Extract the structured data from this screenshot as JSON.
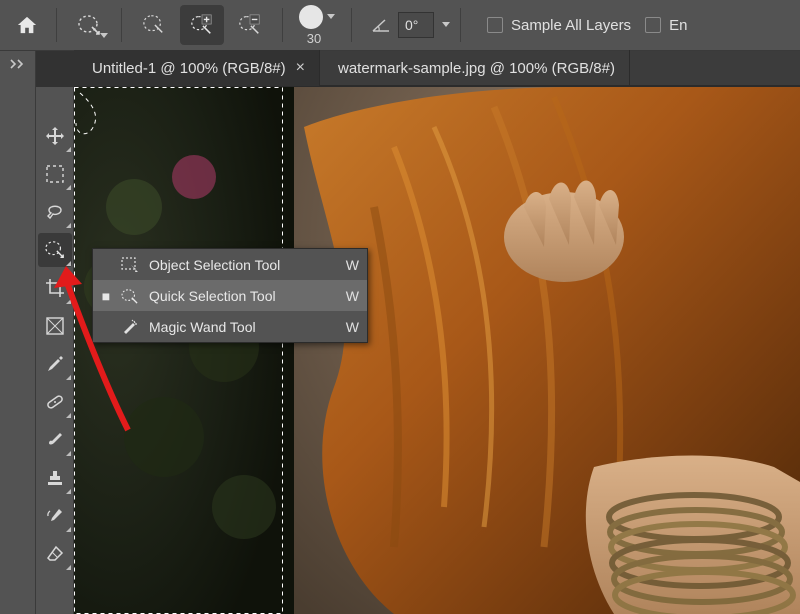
{
  "topbar": {
    "brush_size": "30",
    "angle": "0°",
    "sample_all_layers": "Sample All Layers",
    "enhance_partial": "En"
  },
  "tabs": [
    {
      "label": "Untitled-1 @ 100% (RGB/8#)",
      "active": true,
      "closable": true
    },
    {
      "label": "watermark-sample.jpg @ 100% (RGB/8#)",
      "active": false,
      "closable": false
    }
  ],
  "flyout": {
    "items": [
      {
        "label": "Object Selection Tool",
        "shortcut": "W",
        "selected": false,
        "current": false
      },
      {
        "label": "Quick Selection Tool",
        "shortcut": "W",
        "selected": true,
        "current": true
      },
      {
        "label": "Magic Wand Tool",
        "shortcut": "W",
        "selected": false,
        "current": false
      }
    ]
  },
  "colors": {
    "bg": "#535353",
    "panel": "#3c3c3c",
    "accent_arrow": "#e21b1b"
  }
}
